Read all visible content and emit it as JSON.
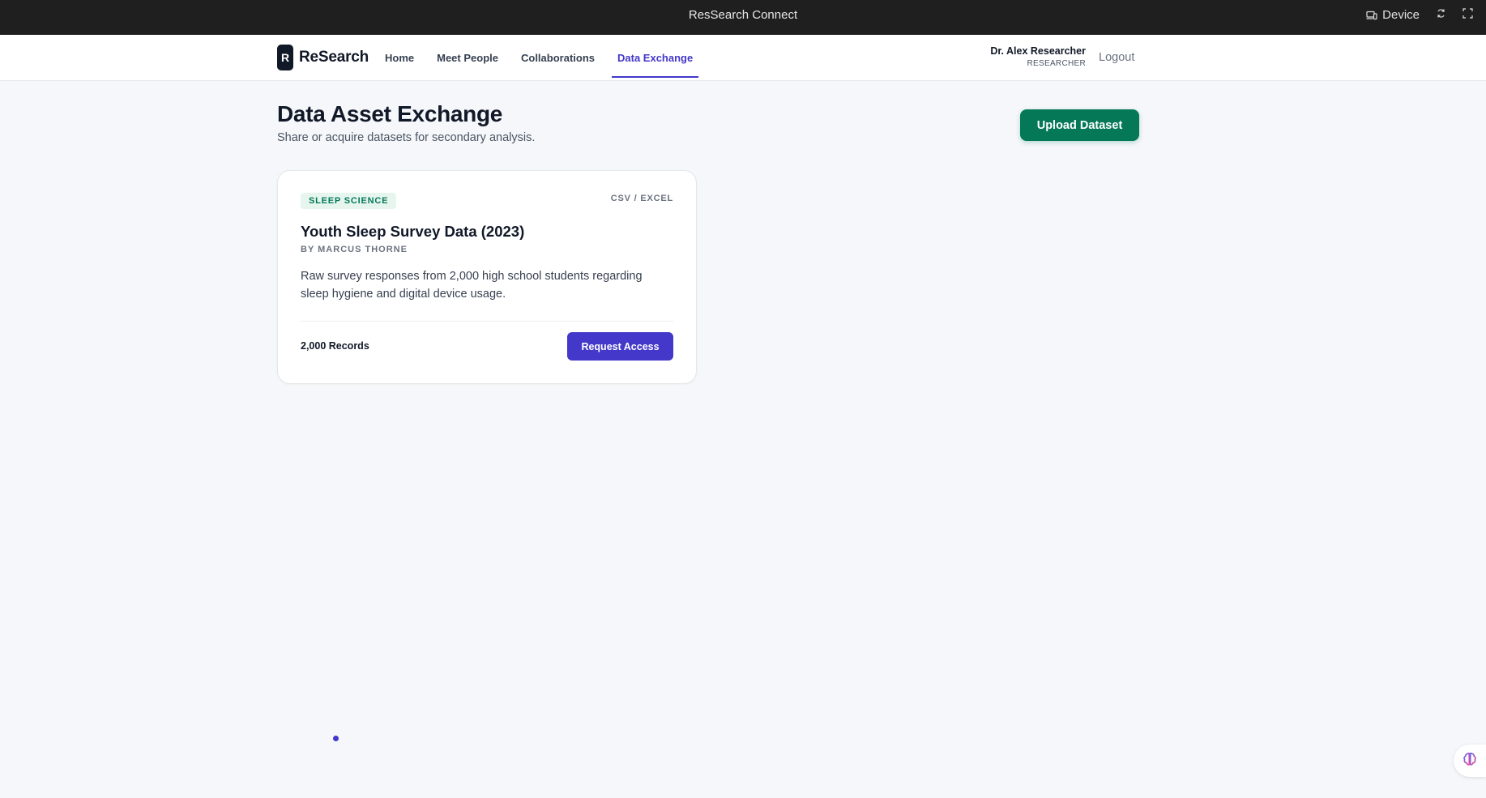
{
  "window": {
    "title": "ResSearch Connect",
    "device_label": "Device"
  },
  "nav": {
    "logo_letter": "R",
    "logo_text": "ReSearch",
    "links": [
      {
        "label": "Home",
        "active": false
      },
      {
        "label": "Meet People",
        "active": false
      },
      {
        "label": "Collaborations",
        "active": false
      },
      {
        "label": "Data Exchange",
        "active": true
      }
    ],
    "user_name": "Dr. Alex Researcher",
    "user_role": "RESEARCHER",
    "logout_label": "Logout"
  },
  "page": {
    "title": "Data Asset Exchange",
    "subtitle": "Share or acquire datasets for secondary analysis.",
    "upload_label": "Upload Dataset"
  },
  "datasets": [
    {
      "category": "SLEEP SCIENCE",
      "format": "CSV / EXCEL",
      "title": "Youth Sleep Survey Data (2023)",
      "author": "BY MARCUS THORNE",
      "description": "Raw survey responses from 2,000 high school students regarding sleep hygiene and digital device usage.",
      "records": "2,000 Records",
      "action_label": "Request Access"
    }
  ],
  "colors": {
    "accent": "#4338ca",
    "success": "#047857",
    "topbar": "#1f1f1f"
  },
  "icons": [
    "device-icon",
    "refresh-icon",
    "fullscreen-icon",
    "ai-assistant-icon"
  ]
}
